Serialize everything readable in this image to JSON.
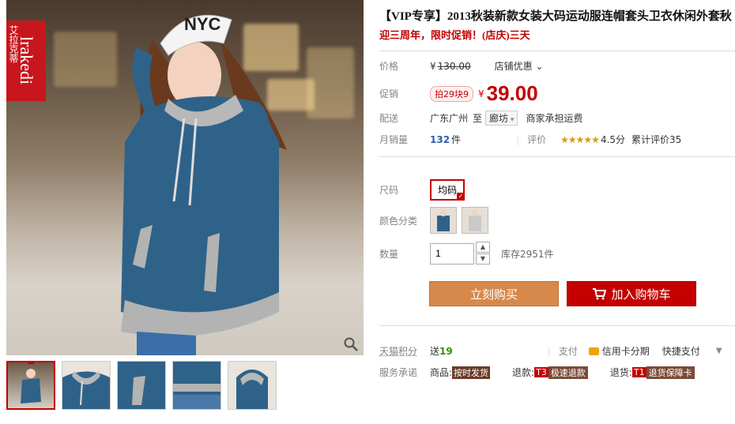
{
  "brand": {
    "latin": "lrakedi",
    "cn": "艾拉克蒂"
  },
  "product": {
    "title": "【VIP专享】2013秋装新款女装大码运动服连帽套头卫衣休闲外套秋",
    "subtitle": "迎三周年，限时促销！(店庆)三天"
  },
  "price": {
    "label": "价格",
    "currency": "¥",
    "original": "130.00",
    "store_discount": "店铺优惠",
    "promo_label": "促销",
    "promo_tag": "拍29块9",
    "current": "39.00"
  },
  "delivery": {
    "label": "配送",
    "from": "广东广州",
    "to_word": "至",
    "to_city": "廊坊",
    "shipping": "商家承担运费"
  },
  "sales": {
    "label": "月销量",
    "count": "132",
    "unit": "件",
    "rating_label": "评价",
    "stars": "★★★★★",
    "score": "4.5分",
    "reviews": "累计评价35"
  },
  "options": {
    "size_label": "尺码",
    "size_value": "均码",
    "color_label": "颜色分类",
    "qty_label": "数量",
    "qty_value": "1",
    "stock": "库存2951件"
  },
  "buttons": {
    "buy": "立刻购买",
    "cart": "加入购物车"
  },
  "extra": {
    "points_label": "天猫积分",
    "points_text": "送",
    "points_value": "19",
    "pay_label": "支付",
    "pay_card": "信用卡分期",
    "pay_quick": "快捷支付",
    "promise_label": "服务承诺",
    "goods": "商品:",
    "goods_badge": "按时发货",
    "refund": "退款:",
    "refund_t": "T3",
    "refund_badge": "极速退款",
    "return": "退货:",
    "return_t": "T1",
    "return_badge": "退货保障卡"
  },
  "colors": {
    "accent": "#c40000",
    "buy_button": "#d7894b",
    "hoodie": "#2f6289"
  }
}
